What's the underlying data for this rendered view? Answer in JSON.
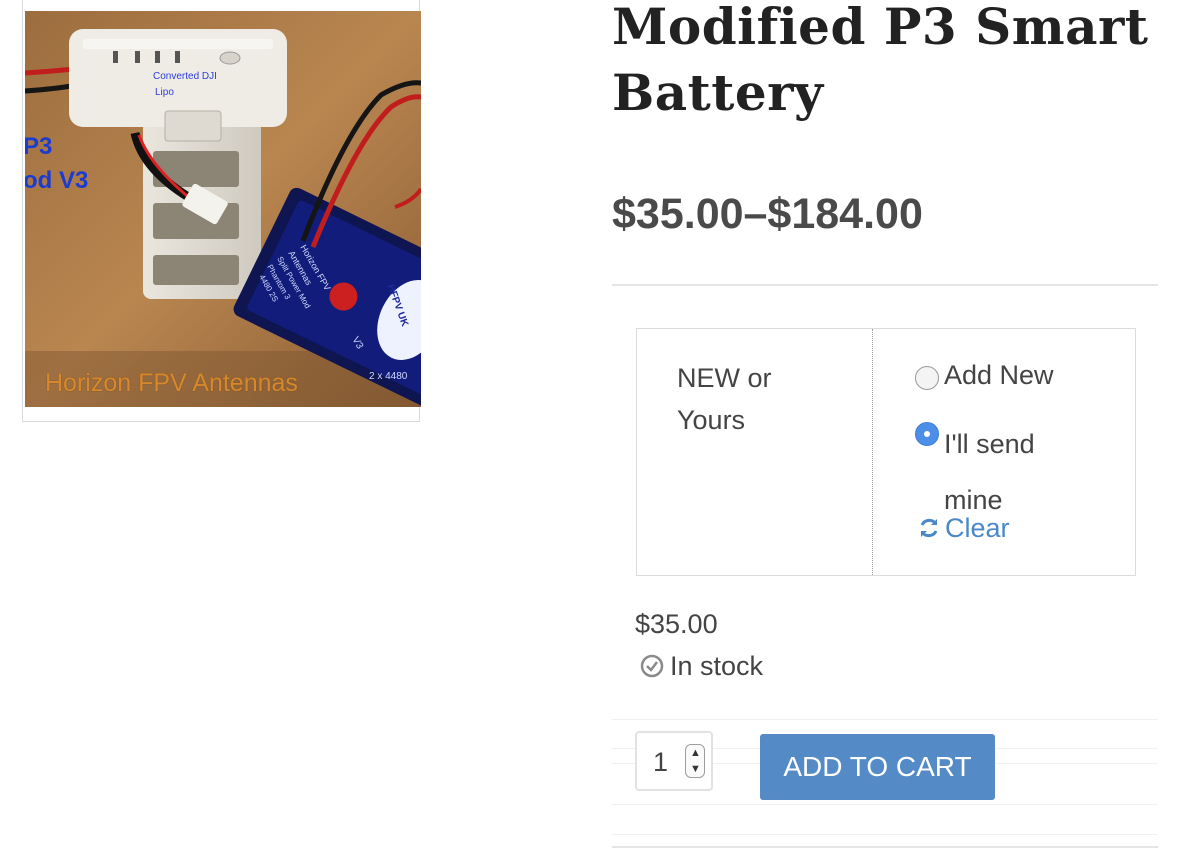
{
  "product": {
    "title": "Modified P3 Smart Battery",
    "price_range": "$35.00–$184.00"
  },
  "gallery": {
    "image_texts": {
      "label_top": "Converted DJI",
      "label_top_2": "Lipo",
      "left_line_1": "P3",
      "left_line_2": "od V3",
      "pack_line_1": "Horizon FPV",
      "pack_line_2": "Antennas",
      "pack_line_3": "Split Power Mod",
      "pack_line_4": "Phantom 3",
      "pack_line_5": "4480 2S",
      "pack_sticker": "HFPV UK",
      "pack_v": "V3",
      "pack_cells": "2 x 4480",
      "caption": "Horizon FPV Antennas"
    }
  },
  "variations": {
    "label": "NEW or Yours",
    "options": [
      {
        "label": "Add New",
        "checked": false
      },
      {
        "label": "I'll send mine",
        "checked": true
      }
    ],
    "clear_label": "Clear"
  },
  "selected_variation": {
    "price": "$35.00",
    "stock": "In stock"
  },
  "cart": {
    "quantity": "1",
    "add_to_cart_label": "ADD TO CART"
  },
  "colors": {
    "accent_button": "#548bc7",
    "link": "#4a88c8",
    "radio_checked": "#4d8ee8"
  }
}
